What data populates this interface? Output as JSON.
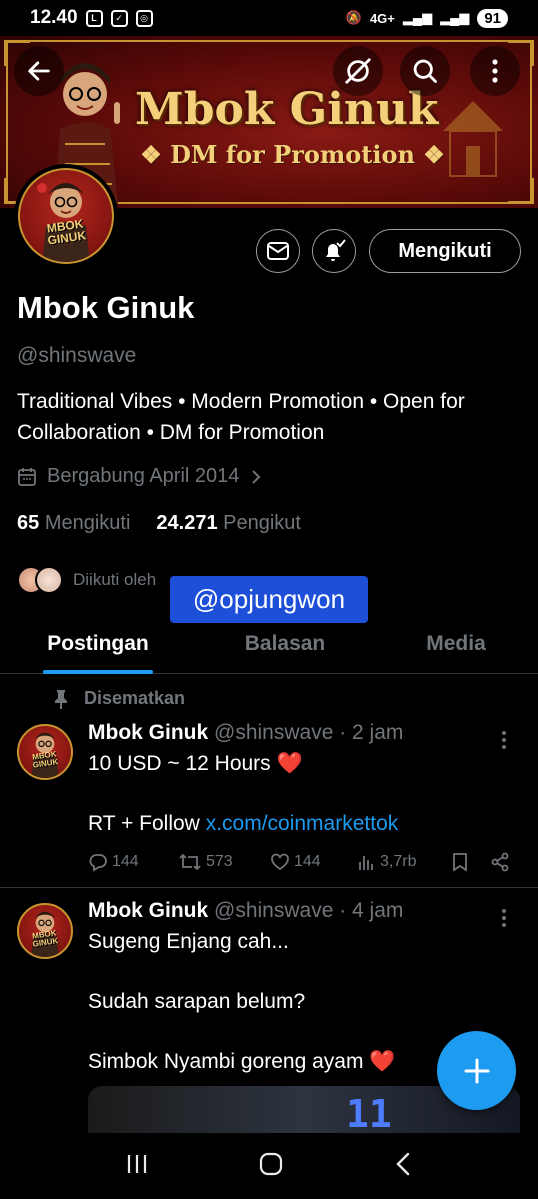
{
  "status": {
    "time": "12.40",
    "network": "4G+",
    "battery": "91"
  },
  "banner": {
    "title": "Mbok Ginuk",
    "subtitle": "❖ DM for Promotion ❖",
    "avatar_text_line1": "MBOK",
    "avatar_text_line2": "GINUK"
  },
  "profile": {
    "name": "Mbok Ginuk",
    "handle": "@shinswave",
    "bio": "Traditional Vibes • Modern Promotion • Open for Collaboration • DM for Promotion",
    "joined": "Bergabung April 2014",
    "following_count": "65",
    "following_label": "Mengikuti",
    "followers_count": "24.271",
    "followers_label": "Pengikut",
    "followed_by": "Diikuti oleh",
    "follow_button": "Mengikuti"
  },
  "overlay_tag": "@opjungwon",
  "tabs": [
    {
      "label": "Postingan",
      "active": true
    },
    {
      "label": "Balasan",
      "active": false
    },
    {
      "label": "Media",
      "active": false
    }
  ],
  "pinned_label": "Disematkan",
  "posts": [
    {
      "name": "Mbok Ginuk",
      "meta": "@shinswave · 2 jam",
      "line1": "10 USD ~ 12 Hours ❤️",
      "line2": "RT + Follow ",
      "link": "x.com/coinmarkettok",
      "replies": "144",
      "reposts": "573",
      "likes": "144",
      "views": "3,7rb"
    },
    {
      "name": "Mbok Ginuk",
      "meta": "@shinswave · 4 jam",
      "line1": "Sugeng Enjang cah...",
      "line2": "Sudah sarapan belum?",
      "line3": "Simbok Nyambi goreng ayam ❤️",
      "media_digits": "11"
    }
  ],
  "colors": {
    "accent": "#1d9bf0",
    "muted": "#71767b",
    "banner_gold": "#f5d07a",
    "banner_red": "#8a1a14"
  }
}
